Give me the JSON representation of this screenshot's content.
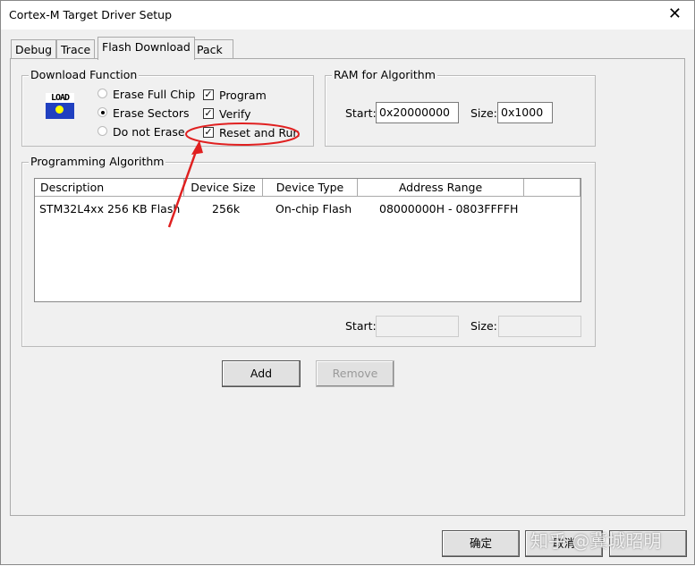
{
  "window": {
    "title": "Cortex-M Target Driver Setup",
    "close": "✕"
  },
  "tabs": [
    {
      "label": "Debug"
    },
    {
      "label": "Trace"
    },
    {
      "label": "Flash Download",
      "active": true
    },
    {
      "label": "Pack"
    }
  ],
  "download_function": {
    "label": "Download Function",
    "icon": "load-icon",
    "icon_text": "LOAD",
    "radios": [
      {
        "label": "Erase Full Chip",
        "selected": false
      },
      {
        "label": "Erase Sectors",
        "selected": true
      },
      {
        "label": "Do not Erase",
        "selected": false
      }
    ],
    "checks": [
      {
        "label": "Program",
        "checked": true
      },
      {
        "label": "Verify",
        "checked": true
      },
      {
        "label": "Reset and Run",
        "checked": true
      }
    ]
  },
  "ram": {
    "label": "RAM for Algorithm",
    "start_label": "Start:",
    "start": "0x20000000",
    "size_label": "Size:",
    "size": "0x1000"
  },
  "algorithm": {
    "label": "Programming Algorithm",
    "columns": [
      "Description",
      "Device Size",
      "Device Type",
      "Address Range"
    ],
    "rows": [
      [
        "STM32L4xx 256 KB Flash",
        "256k",
        "On-chip Flash",
        "08000000H - 0803FFFFH"
      ]
    ],
    "start_label": "Start:",
    "start": "",
    "size_label": "Size:",
    "size": ""
  },
  "buttons": {
    "add": "Add",
    "remove": "Remove",
    "ok": "确定",
    "cancel": "取消",
    "apply": ""
  },
  "annotation": {
    "color": "#e02020"
  },
  "watermark": "知乎 @冀城昭明"
}
